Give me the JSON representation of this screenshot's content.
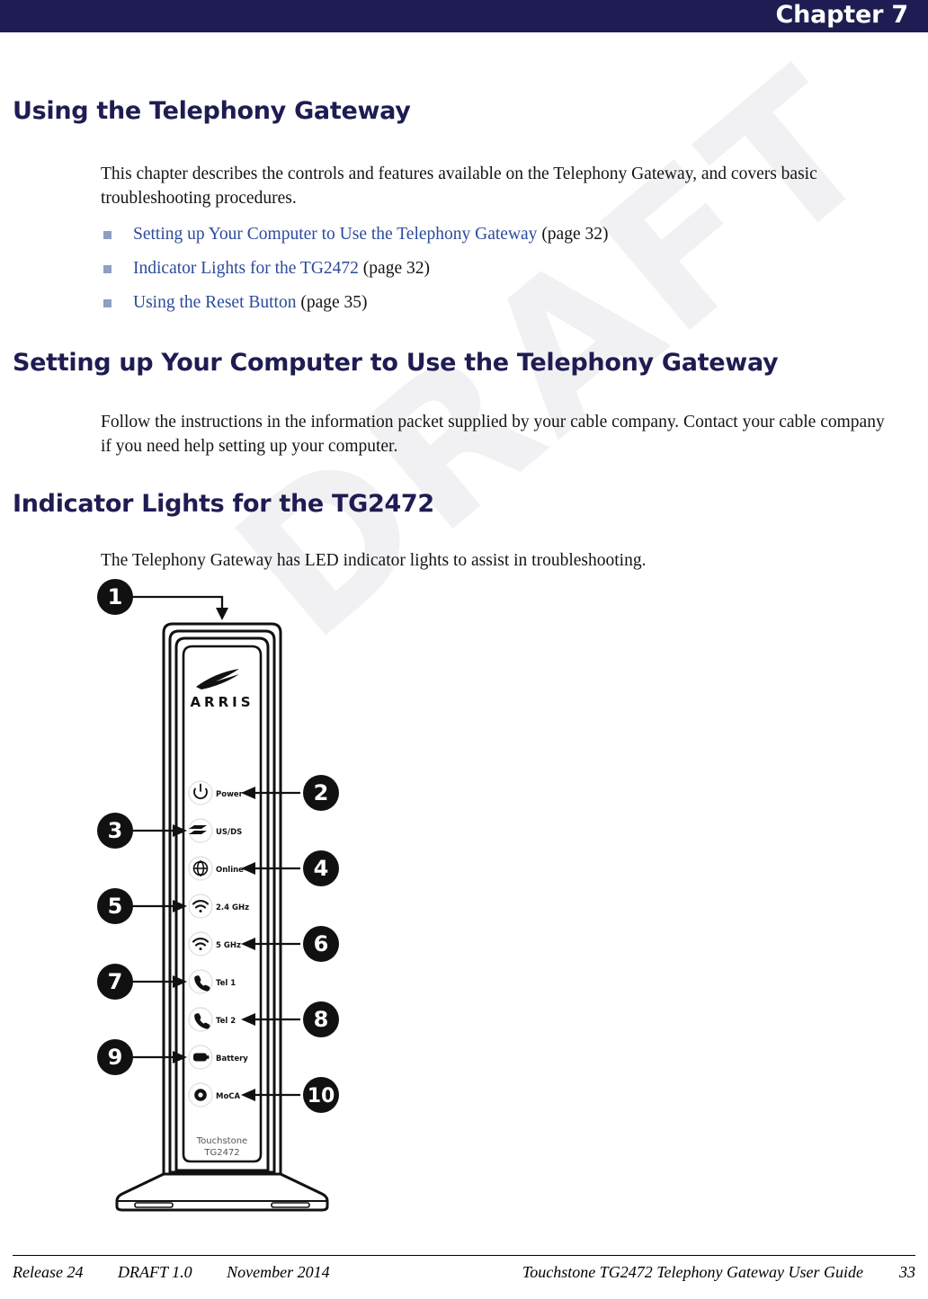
{
  "header": {
    "chapter_label": "Chapter 7",
    "bar_color": "#1e1c52"
  },
  "watermark": {
    "text": "DRAFT",
    "color": "#f1f1f3"
  },
  "sections": {
    "main_title": "Using the Telephony Gateway",
    "intro_paragraph": "This chapter describes the controls and features available on the Telephony Gateway, and covers basic troubleshooting procedures.",
    "links": [
      {
        "label": "Setting up Your Computer to Use the Telephony Gateway",
        "page_ref": "(page 32)"
      },
      {
        "label": "Indicator Lights for the TG2472",
        "page_ref": "(page 32)"
      },
      {
        "label": "Using the Reset Button",
        "page_ref": "(page 35)"
      }
    ],
    "setup_title": "Setting up Your Computer to Use the Telephony Gateway",
    "setup_paragraph": "Follow the instructions in the information packet supplied by your cable company. Contact your cable company if you need help setting up your computer.",
    "leds_title": "Indicator Lights for the TG2472",
    "leds_paragraph": "The Telephony Gateway has LED indicator lights to assist in troubleshooting."
  },
  "figure": {
    "brand": "ARRIS",
    "model_line1": "Touchstone",
    "model_line2": "TG2472",
    "callouts": [
      {
        "number": "1",
        "side": "top"
      },
      {
        "number": "2",
        "side": "right"
      },
      {
        "number": "3",
        "side": "left"
      },
      {
        "number": "4",
        "side": "right"
      },
      {
        "number": "5",
        "side": "left"
      },
      {
        "number": "6",
        "side": "right"
      },
      {
        "number": "7",
        "side": "left"
      },
      {
        "number": "8",
        "side": "right"
      },
      {
        "number": "9",
        "side": "left"
      },
      {
        "number": "10",
        "side": "right"
      }
    ],
    "leds": [
      {
        "label": "Power",
        "icon": "power-icon",
        "callout": "2"
      },
      {
        "label": "US/DS",
        "icon": "updown-icon",
        "callout": "3"
      },
      {
        "label": "Online",
        "icon": "globe-icon",
        "callout": "4"
      },
      {
        "label": "2.4 GHz",
        "icon": "wifi-icon",
        "callout": "5"
      },
      {
        "label": "5 GHz",
        "icon": "wifi-icon",
        "callout": "6"
      },
      {
        "label": "Tel 1",
        "icon": "phone-icon",
        "callout": "7"
      },
      {
        "label": "Tel 2",
        "icon": "phone-icon",
        "callout": "8"
      },
      {
        "label": "Battery",
        "icon": "battery-icon",
        "callout": "9"
      },
      {
        "label": "MoCA",
        "icon": "moca-icon",
        "callout": "10"
      }
    ]
  },
  "footer": {
    "release": "Release 24",
    "draft": "DRAFT 1.0",
    "date": "November 2014",
    "guide_title": "Touchstone TG2472 Telephony Gateway User Guide",
    "page_number": "33"
  }
}
